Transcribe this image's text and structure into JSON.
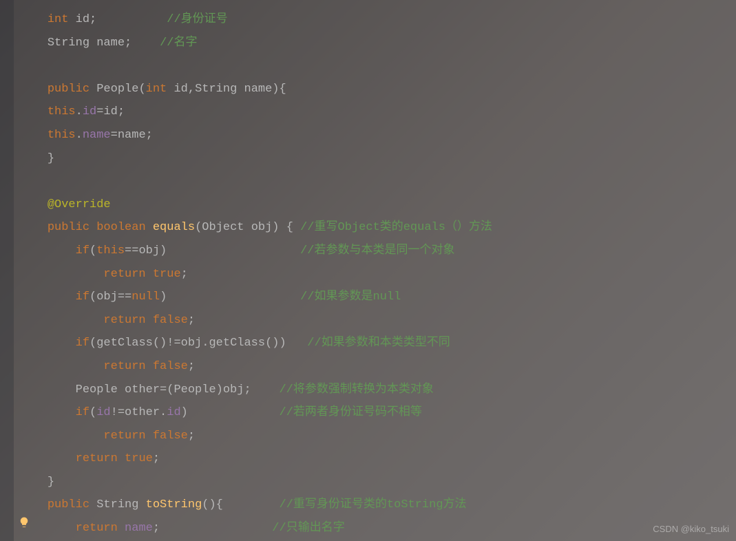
{
  "lines": {
    "l1_kw": "int",
    "l1_id": " id;",
    "l1_pad": "          ",
    "l1_cmt": "//身份证号",
    "l2_type": "String",
    "l2_id": " name;",
    "l2_pad": "    ",
    "l2_cmt": "//名字",
    "l4_kw1": "public",
    "l4_sp1": " ",
    "l4_class": "People",
    "l4_p1": "(",
    "l4_kw2": "int",
    "l4_sp2": " id,",
    "l4_type": "String",
    "l4_sp3": " name){",
    "l5_this": "this",
    "l5_dot": ".",
    "l5_field": "id",
    "l5_eq": "=id;",
    "l6_this": "this",
    "l6_dot": ".",
    "l6_field": "name",
    "l6_eq": "=name;",
    "l7_brace": "}",
    "l9_annot": "@Override",
    "l10_kw1": "public",
    "l10_sp1": " ",
    "l10_kw2": "boolean",
    "l10_sp2": " ",
    "l10_method": "equals",
    "l10_p1": "(Object obj) { ",
    "l10_cmt": "//重写Object类的equals（）方法",
    "l11_kw": "if",
    "l11_p1": "(",
    "l11_this": "this",
    "l11_p2": "==obj)",
    "l11_pad": "                   ",
    "l11_cmt": "//若参数与本类是同一个对象",
    "l12_kw": "return",
    "l12_sp": " ",
    "l12_val": "true",
    "l12_sc": ";",
    "l13_kw": "if",
    "l13_p1": "(obj==",
    "l13_null": "null",
    "l13_p2": ")",
    "l13_pad": "                   ",
    "l13_cmt": "//如果参数是null",
    "l14_kw": "return",
    "l14_sp": " ",
    "l14_val": "false",
    "l14_sc": ";",
    "l15_kw": "if",
    "l15_p1": "(getClass()!=obj.getClass())   ",
    "l15_cmt": "//如果参数和本类类型不同",
    "l16_kw": "return",
    "l16_sp": " ",
    "l16_val": "false",
    "l16_sc": ";",
    "l17_txt": "People other=(People)obj;    ",
    "l17_cmt": "//将参数强制转换为本类对象",
    "l18_kw": "if",
    "l18_p1": "(",
    "l18_field1": "id",
    "l18_op": "!=other.",
    "l18_field2": "id",
    "l18_p2": ")",
    "l18_pad": "             ",
    "l18_cmt": "//若两者身份证号码不相等",
    "l19_kw": "return",
    "l19_sp": " ",
    "l19_val": "false",
    "l19_sc": ";",
    "l20_kw": "return",
    "l20_sp": " ",
    "l20_val": "true",
    "l20_sc": ";",
    "l21_brace": "}",
    "l22_kw1": "public",
    "l22_sp1": " ",
    "l22_type": "String",
    "l22_sp2": " ",
    "l22_method": "toString",
    "l22_p1": "(){",
    "l22_pad": "        ",
    "l22_cmt": "//重写身份证号类的toString方法",
    "l23_kw": "return",
    "l23_sp": " ",
    "l23_field": "name",
    "l23_sc": ";",
    "l23_pad": "                ",
    "l23_cmt": "//只输出名字"
  },
  "watermark": "CSDN @kiko_tsuki",
  "icons": {
    "bulb": "lightbulb-icon"
  }
}
